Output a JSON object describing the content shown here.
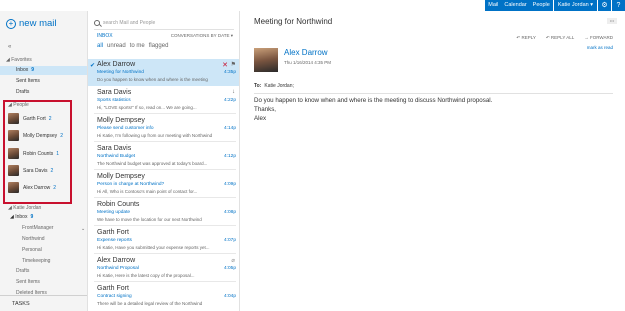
{
  "topnav": {
    "mail": "Mail",
    "calendar": "Calendar",
    "people": "People",
    "user": "Katie Jordan",
    "settings_icon": "gear-icon",
    "help_icon": "help-icon"
  },
  "left": {
    "new_mail": "new mail",
    "favorites_label": "Favorites",
    "favorites": [
      {
        "label": "Inbox",
        "count": "9"
      },
      {
        "label": "Sent Items",
        "count": ""
      },
      {
        "label": "Drafts",
        "count": ""
      }
    ],
    "people_label": "People",
    "people": [
      {
        "name": "Garth Fort",
        "count": "2"
      },
      {
        "name": "Molly Dempsey",
        "count": "2"
      },
      {
        "name": "Robin Counts",
        "count": "1"
      },
      {
        "name": "Sara Davis",
        "count": "2"
      },
      {
        "name": "Alex Darrow",
        "count": "2"
      }
    ],
    "account_label": "Katie Jordan",
    "inbox": {
      "label": "Inbox",
      "count": "9"
    },
    "subfolders": [
      "FrontManager",
      "Northwind",
      "Personal",
      "Timekeeping"
    ],
    "folders": [
      "Drafts",
      "Sent Items",
      "Deleted Items"
    ],
    "tasks": "TASKS"
  },
  "list": {
    "search_placeholder": "search Mail and People",
    "folder": "INBOX",
    "sort": "CONVERSATIONS BY DATE ▾",
    "filters": [
      "all",
      "unread",
      "to me",
      "flagged"
    ],
    "messages": [
      {
        "from": "Alex Darrow",
        "subject": "Meeting for Northwind",
        "preview": "Do you happen to know when and where is the meeting",
        "time": "4:35p"
      },
      {
        "from": "Sara Davis",
        "subject": "Sports statistics",
        "preview": "Hi, \"LOVE sports!\" If so, read on... We are going...",
        "time": "4:22p"
      },
      {
        "from": "Molly Dempsey",
        "subject": "Please send customer info",
        "preview": "Hi Katie, I'm following up from our meeting with Northwind",
        "time": "4:14p"
      },
      {
        "from": "Sara Davis",
        "subject": "Northwind Budget",
        "preview": "The Northwind budget was approved at today's board...",
        "time": "4:12p"
      },
      {
        "from": "Molly Dempsey",
        "subject": "Person in charge at Northwind?",
        "preview": "Hi All, Who is Contoso's main point of contact for...",
        "time": "4:09p"
      },
      {
        "from": "Robin Counts",
        "subject": "Meeting update",
        "preview": "We have to move the location for our next Northwind",
        "time": "4:08p"
      },
      {
        "from": "Garth Fort",
        "subject": "Expense reports",
        "preview": "Hi Katie, Have you submitted your expense reports yet...",
        "time": "4:07p"
      },
      {
        "from": "Alex Darrow",
        "subject": "Northwind Proposal",
        "preview": "Hi Katie, Here is the latest copy of the proposal...",
        "time": "4:05p"
      },
      {
        "from": "Garth Fort",
        "subject": "Contract signing",
        "preview": "There will be a detailed legal review of the Northwind",
        "time": "4:04p"
      }
    ]
  },
  "read": {
    "subject": "Meeting for Northwind",
    "reply": "↶ REPLY",
    "reply_all": "↶ REPLY ALL",
    "forward": "→ FORWARD",
    "mark_as_read": "mark as read",
    "sender": "Alex Darrow",
    "sent": "Thu 1/16/2014 4:35 PM",
    "to_label": "To:",
    "to": "Katie Jordan;",
    "body_1": "Do you happen to know when and where is the meeting to discuss Northwind proposal.",
    "body_2": "Thanks,",
    "body_3": "Alex"
  }
}
